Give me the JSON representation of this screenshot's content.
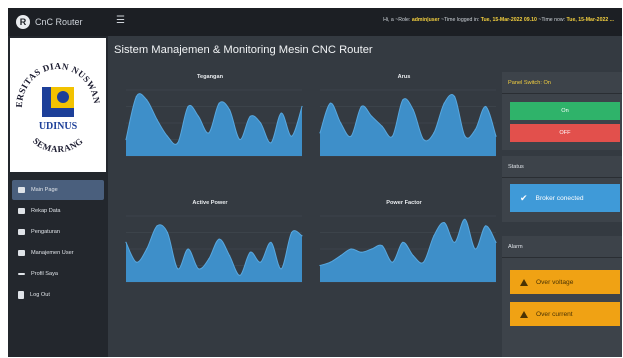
{
  "app": {
    "brand": "CnC Router",
    "page_title": "Sistem Manajemen & Monitoring Mesin CNC Router"
  },
  "topbar": {
    "greeting": "Hi, a ~Role: ",
    "role": "admin|user",
    "login_label": " ~Time logged in: ",
    "login_time": "Tue, 15-Mar-2022 09.10",
    "now_label": " ~Time now: ",
    "now_time": "Tue, 15-Mar-2022 ..."
  },
  "logo": {
    "arc_top": "UNIVERSITAS DIAN NUSWANTORO",
    "center": "UDINUS",
    "bottom": "SEMARANG"
  },
  "sidebar": {
    "items": [
      {
        "label": "Main Page",
        "icon": "grid-icon",
        "active": true
      },
      {
        "label": "Rekap Data",
        "icon": "table-icon",
        "active": false
      },
      {
        "label": "Pengaturan",
        "icon": "settings-icon",
        "active": false
      },
      {
        "label": "Manajemen User",
        "icon": "users-icon",
        "active": false
      },
      {
        "label": "Profil Saya",
        "icon": "profile-icon",
        "active": false
      },
      {
        "label": "Log Out",
        "icon": "logout-icon",
        "active": false
      }
    ]
  },
  "colors": {
    "area_fill": "#3e8fc9",
    "area_stroke": "#57a7df",
    "on": "#2fb36a",
    "off": "#e2504c",
    "info": "#3f9ad8",
    "warning": "#f0a214"
  },
  "chart_data": [
    {
      "type": "area",
      "title": "Tegangan",
      "values": [
        0.25,
        0.9,
        0.85,
        0.55,
        0.3,
        0.2,
        0.75,
        0.6,
        0.35,
        0.8,
        0.7,
        0.25,
        0.6,
        0.5,
        0.2,
        0.65,
        0.3,
        0.75
      ]
    },
    {
      "type": "area",
      "title": "Arus",
      "values": [
        0.35,
        0.8,
        0.5,
        0.3,
        0.75,
        0.6,
        0.45,
        0.3,
        0.85,
        0.7,
        0.25,
        0.35,
        0.8,
        0.9,
        0.3,
        0.4,
        0.75,
        0.3
      ]
    },
    {
      "type": "area",
      "title": "Active Power",
      "values": [
        0.6,
        0.3,
        0.5,
        0.85,
        0.75,
        0.2,
        0.5,
        0.2,
        0.35,
        0.65,
        0.4,
        0.1,
        0.45,
        0.3,
        0.6,
        0.2,
        0.75,
        0.7
      ]
    },
    {
      "type": "area",
      "title": "Power Factor",
      "values": [
        0.25,
        0.3,
        0.4,
        0.5,
        0.45,
        0.5,
        0.55,
        0.3,
        0.6,
        0.4,
        0.3,
        0.7,
        0.9,
        0.6,
        0.95,
        0.5,
        0.85,
        0.6
      ]
    }
  ],
  "panels": {
    "switch_title": "Panel Switch: On",
    "on_label": "On",
    "off_label": "OFF",
    "status_title": "Status",
    "status_text": "Broker conected",
    "alarm_title": "Alarm",
    "alarm_items": [
      "Over voltage",
      "Over current"
    ]
  }
}
